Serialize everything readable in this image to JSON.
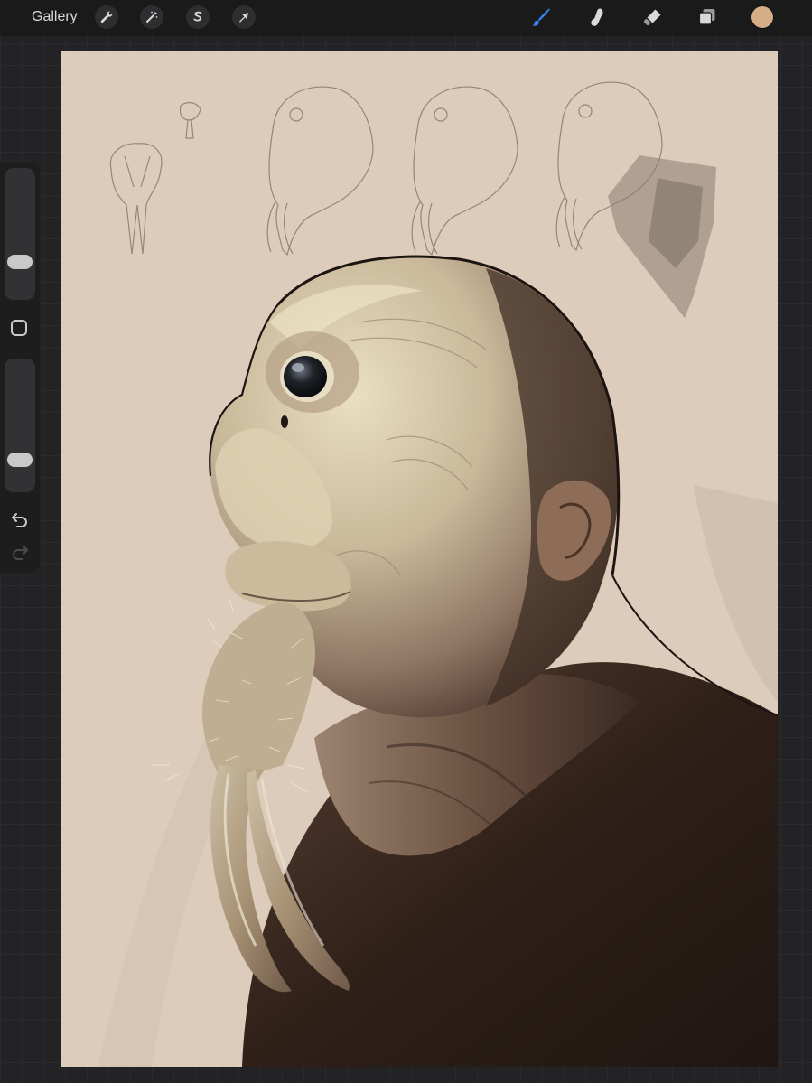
{
  "toolbar": {
    "gallery_label": "Gallery",
    "actions_icon": "wrench-icon",
    "adjustments_icon": "magic-wand-icon",
    "selection_icon": "selection-s-icon",
    "transform_icon": "arrow-cursor-icon",
    "brush_icon": "brush-icon",
    "smudge_icon": "smudge-icon",
    "eraser_icon": "eraser-icon",
    "layers_icon": "layers-icon",
    "active_tool": "brush",
    "active_color": "#d3ad86",
    "accent": "#3b82f6"
  },
  "sidebar": {
    "brush_size": 0.25,
    "brush_opacity": 0.2,
    "modify_icon": "square-icon",
    "undo_icon": "undo-icon",
    "redo_icon": "redo-icon"
  },
  "canvas": {
    "background": "#ddcbbc",
    "subject": "creature-portrait-with-tusks"
  }
}
